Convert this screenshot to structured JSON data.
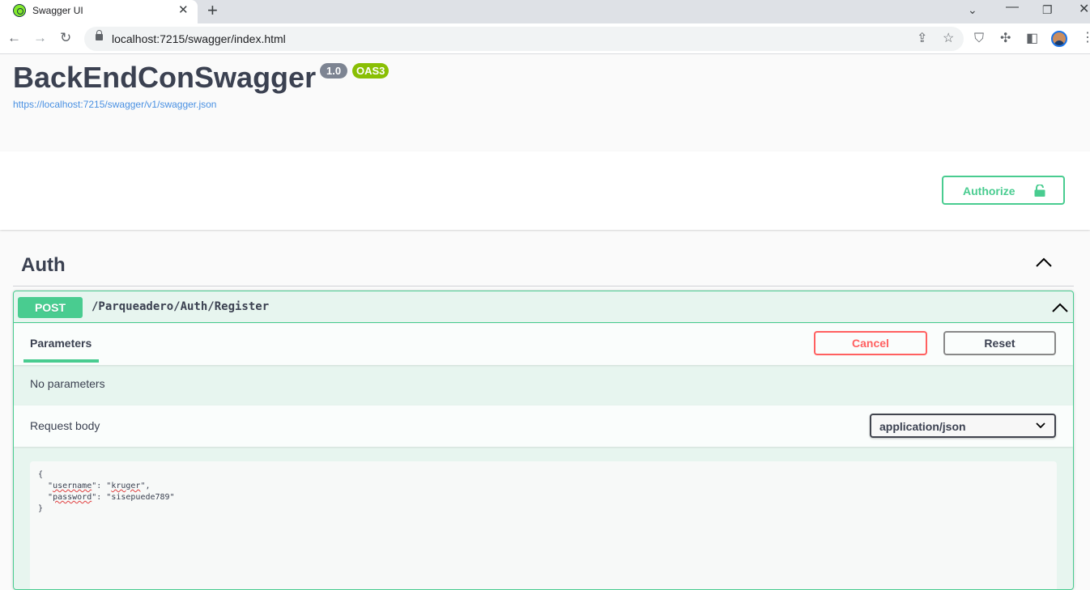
{
  "browser": {
    "tab_title": "Swagger UI",
    "tab_close": "✕",
    "new_tab": "+",
    "url": "localhost:7215/swagger/index.html",
    "window_controls": {
      "chevron": "⌄",
      "minimize": "—",
      "maximize": "❐",
      "close": "✕"
    },
    "nav": {
      "back": "←",
      "forward": "→",
      "reload": "↻"
    },
    "omnibox_actions": {
      "share": "⇪",
      "star": "☆"
    },
    "extensions": {
      "shield": "⛉",
      "puzzle": "✣",
      "panel": "◧"
    },
    "menu": "⋮"
  },
  "info": {
    "title": "BackEndConSwagger",
    "version": "1.0",
    "oas": "OAS3",
    "spec_url": "https://localhost:7215/swagger/v1/swagger.json"
  },
  "auth": {
    "authorize_label": "Authorize"
  },
  "tag": {
    "name": "Auth"
  },
  "operation": {
    "method": "POST",
    "path": "/Parqueadero/Auth/Register",
    "parameters_tab": "Parameters",
    "cancel_label": "Cancel",
    "reset_label": "Reset",
    "no_parameters": "No parameters",
    "request_body_label": "Request body",
    "content_type": "application/json",
    "body_json": {
      "open": "{",
      "username_key": "username",
      "username_value": "kruger",
      "password_key": "password",
      "password_value": "sisepuede789",
      "close": "}"
    }
  },
  "colors": {
    "post_green": "#49cc90",
    "cancel_red": "#ff6060",
    "link_blue": "#4990e2",
    "version_grey": "#7d8492",
    "oas_green": "#89bf04",
    "text_dark": "#3b4151"
  }
}
